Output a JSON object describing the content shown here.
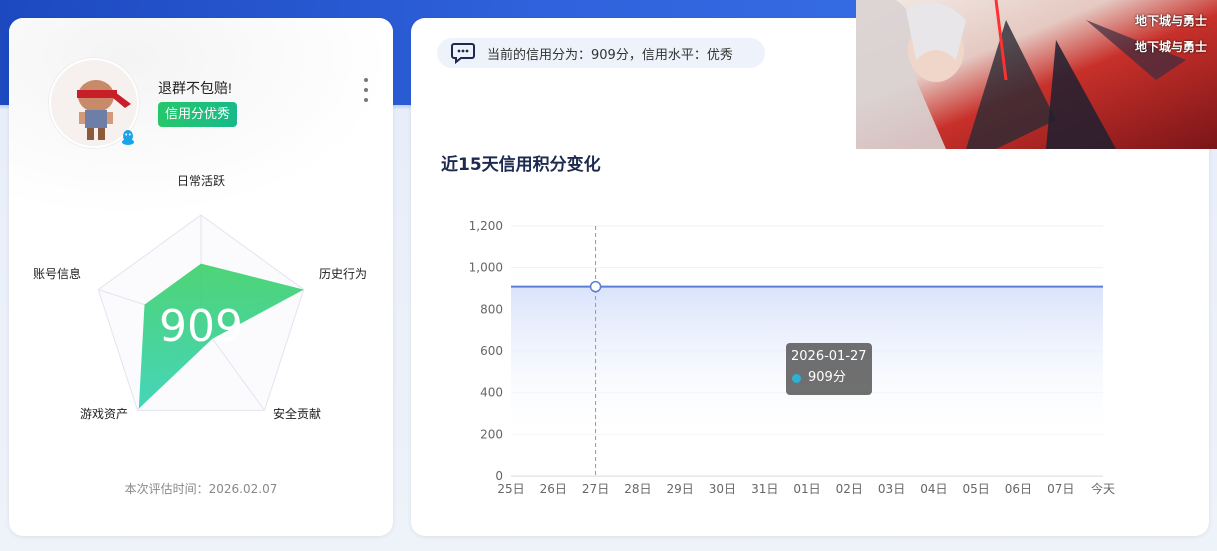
{
  "profile": {
    "username": "退群不包赔!",
    "credit_tag": "信用分优秀",
    "score": "909",
    "eval_time": "本次评估时间：2026.02.07"
  },
  "radar": {
    "labels": {
      "daily": "日常活跃",
      "history": "历史行为",
      "security": "安全贡献",
      "assets": "游戏资产",
      "account": "账号信息"
    },
    "values": {
      "daily": 0.55,
      "history": 1.0,
      "security": 0.18,
      "assets": 0.98,
      "account": 0.55
    }
  },
  "message": {
    "text": "当前的信用分为：909分，信用水平：优秀"
  },
  "chart_title": "近15天信用积分变化",
  "chart_data": {
    "type": "area",
    "title": "近15天信用积分变化",
    "categories": [
      "25日",
      "26日",
      "27日",
      "28日",
      "29日",
      "30日",
      "31日",
      "01日",
      "02日",
      "03日",
      "04日",
      "05日",
      "06日",
      "07日",
      "今天"
    ],
    "series": [
      {
        "values": [
          909,
          909,
          909,
          909,
          909,
          909,
          909,
          909,
          909,
          909,
          909,
          909,
          909,
          909,
          909
        ]
      }
    ],
    "ylim": [
      0,
      1200
    ],
    "yticks": [
      "0",
      "200",
      "400",
      "600",
      "800",
      "1,000",
      "1,200"
    ],
    "grid": true,
    "highlight_index": 2
  },
  "tooltip": {
    "date": "2026-01-27",
    "value": "909分"
  },
  "colors": {
    "accent": "#2f62dc",
    "line": "#5b7fd6",
    "tag_green": "#27c76b",
    "radar_fill": "#2fd07a"
  },
  "banner": {
    "logo_text_1": "地下城与勇士",
    "logo_text_2": "地下城与勇士"
  }
}
